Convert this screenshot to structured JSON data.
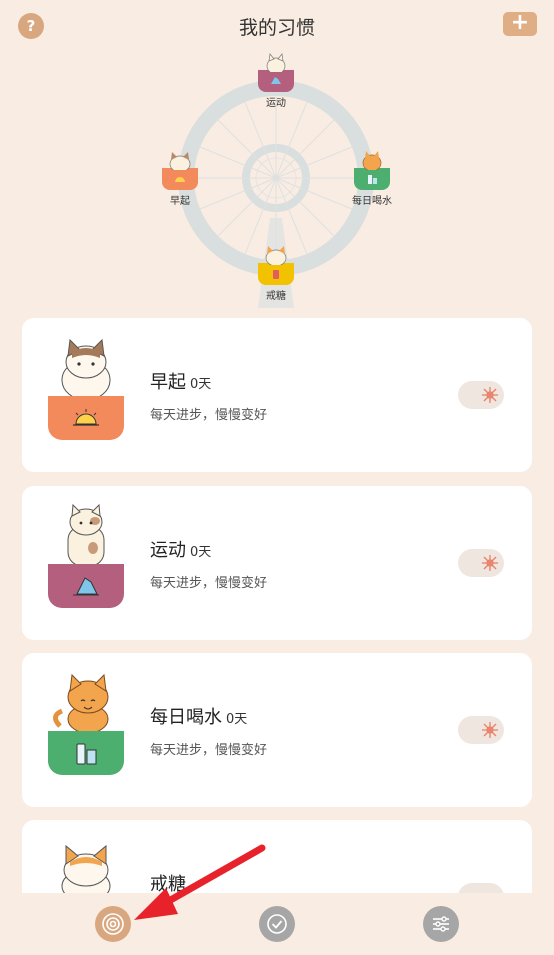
{
  "header": {
    "help": "?",
    "title": "我的习惯",
    "add": "+"
  },
  "wheel": {
    "cabins": [
      {
        "label": "运动",
        "color": "#b45f7e"
      },
      {
        "label": "早起",
        "color": "#f28a5c"
      },
      {
        "label": "每日喝水",
        "color": "#4caf6f"
      },
      {
        "label": "戒糖",
        "color": "#f2c200"
      }
    ]
  },
  "habits": [
    {
      "name": "早起",
      "days": "0天",
      "desc": "每天进步，慢慢变好",
      "color": "#f28a5c",
      "icon": "sunrise-icon"
    },
    {
      "name": "运动",
      "days": "0天",
      "desc": "每天进步，慢慢变好",
      "color": "#b45f7e",
      "icon": "running-shoe-icon"
    },
    {
      "name": "每日喝水",
      "days": "0天",
      "desc": "每天进步，慢慢变好",
      "color": "#4caf6f",
      "icon": "water-bottle-icon"
    },
    {
      "name": "戒糖",
      "days": "",
      "desc": "",
      "color": "#f2c200",
      "icon": "candy-icon"
    }
  ],
  "nav": {
    "items": [
      {
        "icon": "target-icon",
        "color": "#d9a77f"
      },
      {
        "icon": "check-circle-icon",
        "color": "#a6a6a6"
      },
      {
        "icon": "sliders-icon",
        "color": "#a6a6a6"
      }
    ]
  },
  "colors": {
    "accent": "#d9a77f",
    "background": "#f9ece2",
    "arrow": "#e8222a"
  }
}
